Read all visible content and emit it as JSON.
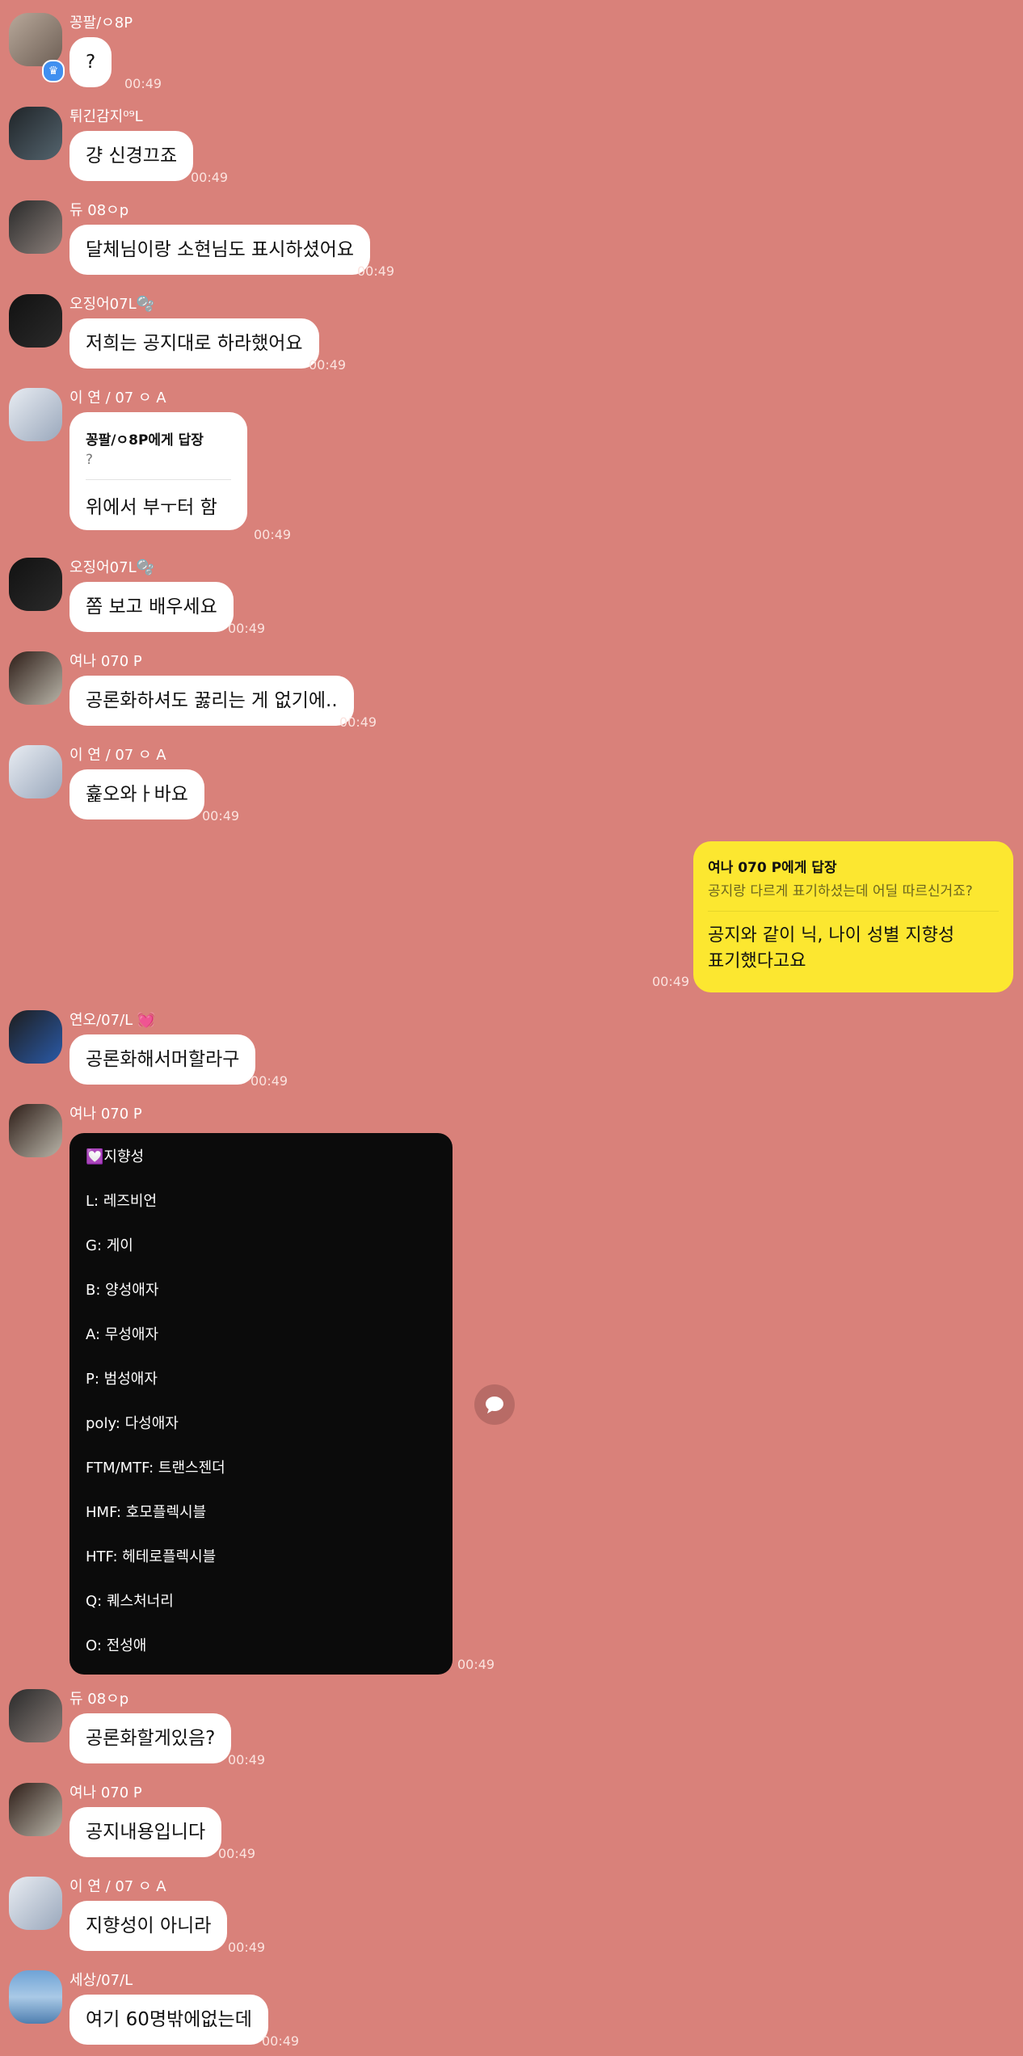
{
  "colors": {
    "background": "#d9817a",
    "bubble_other": "#ffffff",
    "bubble_self": "#fce730",
    "dark_bubble": "#0b0b0b"
  },
  "messages": [
    {
      "sender": "꽁팔/ㅇ8P",
      "text": "?",
      "time": "00:49"
    },
    {
      "sender": "튀긴감지⁰⁹L",
      "text": "걍 신경끄죠",
      "time": "00:49"
    },
    {
      "sender": "듀 08ㅇp",
      "text": "달체님이랑 소현님도 표시하셨어요",
      "time": "00:49"
    },
    {
      "sender": "오징어07L🫧",
      "text": "저희는 공지대로 하라했어요",
      "time": "00:49"
    },
    {
      "sender": "이 연 / 07 ㅇ A",
      "reply_to": "꽁팔/ㅇ8P에게 답장",
      "reply_quote": "?",
      "text": "위에서 부ㅜ터 함",
      "time": "00:49"
    },
    {
      "sender": "오징어07L🫧",
      "text": "쫌 보고 배우세요",
      "time": "00:49"
    },
    {
      "sender": "여나 070 P",
      "text": "공론화하셔도 꿇리는 게 없기에..",
      "time": "00:49"
    },
    {
      "sender": "이 연 / 07 ㅇ A",
      "text": "흁오와ㅏ바요",
      "time": "00:49"
    },
    {
      "sender": "",
      "self": true,
      "reply_to": "여나 070 P에게 답장",
      "reply_quote": "공지랑 다르게 표기하셨는데 어딜 따르신거죠?",
      "text_line1": "공지와 같이 닉, 나이 성별 지향성",
      "text_line2": "표기했다고요",
      "time": "00:49"
    },
    {
      "sender": "연오/07/L 💓",
      "text": "공론화해서머할라구",
      "time": "00:49"
    },
    {
      "sender": "여나 070 P",
      "list": [
        "💟지향성",
        "L: 레즈비언",
        "G: 게이",
        "B: 양성애자",
        "A: 무성애자",
        "P: 범성애자",
        "poly: 다성애자",
        "FTM/MTF: 트랜스젠더",
        "HMF: 호모플렉시블",
        "HTF: 헤테로플렉시블",
        "Q: 퀘스처너리",
        "O: 전성애"
      ],
      "time": "00:49"
    },
    {
      "sender": "듀 08ㅇp",
      "text": "공론화할게있음?",
      "time": "00:49"
    },
    {
      "sender": "여나 070 P",
      "text": "공지내용입니다",
      "time": "00:49"
    },
    {
      "sender": "이 연 / 07 ㅇ A",
      "text": "지향성이 아니라",
      "time": "00:49"
    },
    {
      "sender": "세상/07/L",
      "text": "여기 60명밖에없는데",
      "time": "00:49"
    }
  ]
}
